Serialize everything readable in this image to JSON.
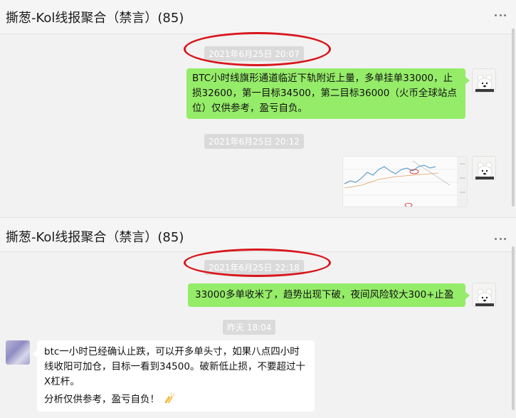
{
  "panel1": {
    "title": "撕葱-Kol线报聚合（禁言）(85)",
    "ts1": "2021年6月25日 20:07",
    "msg1": "BTC小时线旗形通道临近下轨附近上量，多单挂单33000，止损32600，第一目标34500，第二目标36000（火币全球站点位）仅供参考，盈亏自负。",
    "ts2": "2021年6月25日 20:12"
  },
  "panel2": {
    "title": "撕葱-Kol线报聚合（禁言）(85)",
    "ts1": "2021年6月25日 22:18",
    "msg1": "33000多单收米了，趋势出现下破，夜间风险较大300+止盈",
    "ts2": "昨天 18:04",
    "msg2_line1": "btc一小时已经确认止跌，可以开多单头寸，如果八点四小时线收阳可加仓，目标一看到34500。破新低止损，不要超过十X杠杆。",
    "msg2_line2": "分析仅供参考，盈亏自负！"
  },
  "colors": {
    "bubble_green": "#95ec69",
    "highlight_red": "#d8161c"
  },
  "icons": [
    "more-icon",
    "pin-icon",
    "minimize-icon",
    "bear-avatar",
    "clap-emoji"
  ]
}
